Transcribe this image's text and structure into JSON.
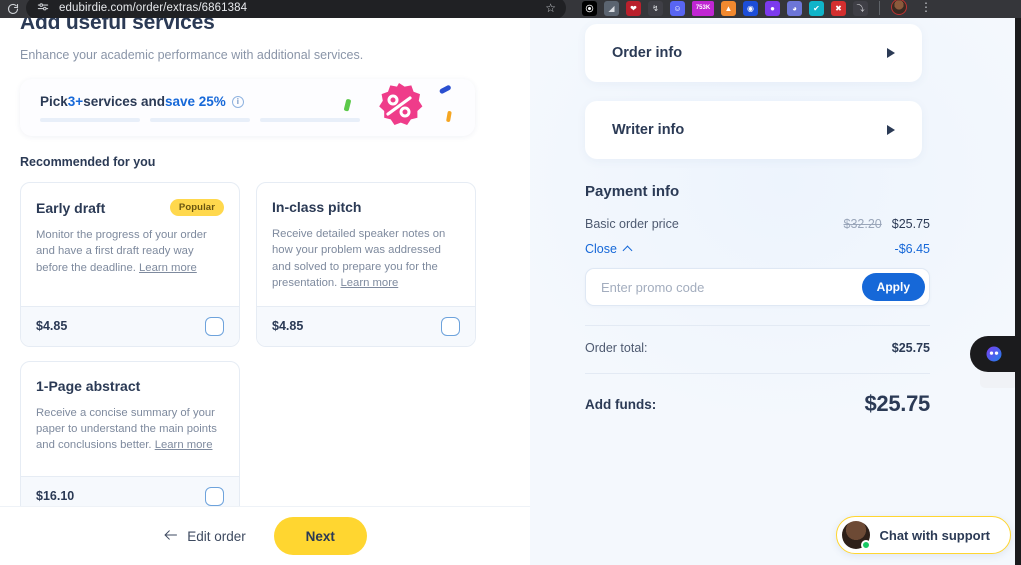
{
  "browser": {
    "url": "edubirdie.com/order/extras/6861384",
    "reload_icon": "reload-icon",
    "site_settings_icon": "site-settings-icon",
    "bookmark_icon": "star-outline-icon",
    "menu_icon": "three-dot-menu-icon",
    "extensions": [
      {
        "name": "extension-icon-1",
        "glyph": "⚙",
        "bg": "#000000",
        "fg": "#ffffff"
      },
      {
        "name": "extension-icon-2",
        "glyph": "◢",
        "bg": "#4b5563",
        "fg": "#d1d5db"
      },
      {
        "name": "extension-icon-3",
        "glyph": "♥",
        "bg": "#c62828",
        "fg": "#ffffff"
      },
      {
        "name": "extension-icon-4",
        "glyph": "↯",
        "bg": "#3f3f46",
        "fg": "#e5e7eb"
      },
      {
        "name": "extension-icon-5",
        "glyph": "●●",
        "bg": "#5865f2",
        "fg": "#ffffff"
      },
      {
        "name": "extension-icon-6",
        "glyph": "753K",
        "bg": "#c026d3",
        "fg": "#ffffff"
      },
      {
        "name": "extension-icon-7",
        "glyph": "▲",
        "bg": "#f97316",
        "fg": "#ffffff"
      },
      {
        "name": "extension-icon-8",
        "glyph": "◉",
        "bg": "#1d4ed8",
        "fg": "#ffffff"
      },
      {
        "name": "extension-icon-9",
        "glyph": "●",
        "bg": "#7c3aed",
        "fg": "#ffffff"
      },
      {
        "name": "extension-icon-10",
        "glyph": "◔",
        "bg": "#6366f1",
        "fg": "#ffffff"
      },
      {
        "name": "extension-icon-11",
        "glyph": "✔",
        "bg": "#06b6d4",
        "fg": "#ffffff"
      },
      {
        "name": "extension-icon-12",
        "glyph": "✖",
        "bg": "#dc2626",
        "fg": "#ffffff"
      },
      {
        "name": "extension-icon-13",
        "glyph": "⤵",
        "bg": "#3f3f46",
        "fg": "#d4d4d8"
      }
    ]
  },
  "main": {
    "title": "Add useful services",
    "subtitle": "Enhance your academic performance with additional services.",
    "promo_banner": {
      "text_prefix": "Pick ",
      "text_count": "3+",
      "text_middle": " services and ",
      "text_save": "save 25%",
      "info_icon": "info-icon",
      "steps_filled": 0,
      "steps_total": 3,
      "art_icon": "discount-percent-badge-icon"
    },
    "recommended_heading": "Recommended for you",
    "services": [
      {
        "title": "Early draft",
        "badge": "Popular",
        "description": "Monitor the progress of your order and have a first draft ready way before the deadline. ",
        "learn_more": "Learn more",
        "price": "$4.85",
        "checked": false
      },
      {
        "title": "In-class pitch",
        "badge": "",
        "description": "Receive detailed speaker notes on how your problem was addressed and solved to prepare you for the presentation. ",
        "learn_more": "Learn more",
        "price": "$4.85",
        "checked": false
      },
      {
        "title": "1-Page abstract",
        "badge": "",
        "description": "Receive a concise summary of your paper to understand the main points and conclusions better. ",
        "learn_more": "Learn more",
        "price": "$16.10",
        "checked": false
      }
    ],
    "footer": {
      "back_arrow_icon": "arrow-left-icon",
      "edit_order_label": "Edit order",
      "next_label": "Next"
    }
  },
  "sidebar": {
    "accordions": [
      {
        "label": "Order info",
        "arrow_icon": "triangle-right-icon",
        "expanded": false
      },
      {
        "label": "Writer info",
        "arrow_icon": "triangle-right-icon",
        "expanded": false
      }
    ],
    "payment": {
      "title": "Payment info",
      "basic_price_label": "Basic order price",
      "basic_price_old": "$32.20",
      "basic_price_new": "$25.75",
      "close_label": "Close",
      "close_chevron_icon": "chevron-up-icon",
      "discount_value": "-$6.45",
      "promo_placeholder": "Enter promo code",
      "promo_value": "",
      "apply_label": "Apply",
      "order_total_label": "Order total:",
      "order_total_value": "$25.75",
      "add_funds_label": "Add funds:",
      "add_funds_value": "$25.75"
    }
  },
  "widgets": {
    "chat_fab_icon": "chat-bubble-face-icon",
    "support": {
      "label": "Chat with support",
      "avatar_icon": "support-agent-avatar",
      "status_icon": "online-status-dot"
    }
  },
  "colors": {
    "accent_blue": "#1668d8",
    "accent_yellow": "#ffd630",
    "badge_yellow": "#ffd84d",
    "text_dark": "#2b3a55",
    "text_muted": "#7e8a9e",
    "panel_bg": "#f3f7fc",
    "chrome_bg": "#35363a"
  }
}
